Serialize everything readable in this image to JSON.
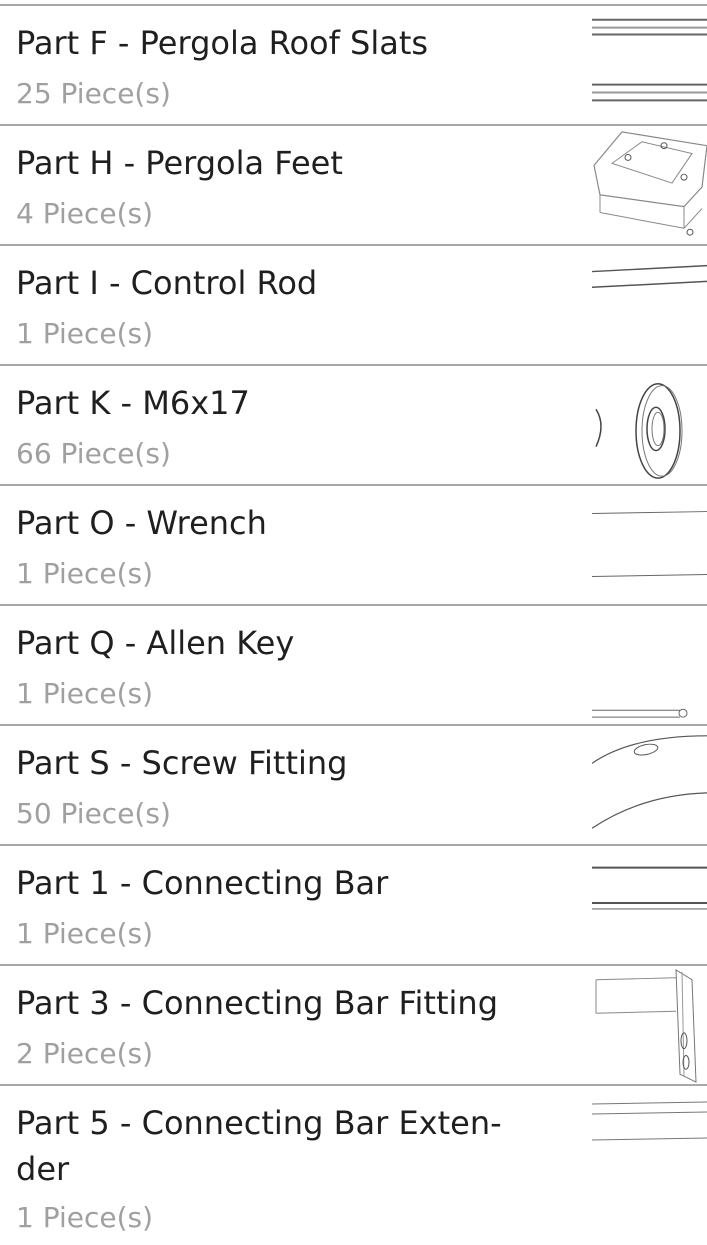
{
  "parts": [
    {
      "title": "Part F - Pergola Roof Slats",
      "qty": "25 Piece(s)",
      "icon": "slats-icon"
    },
    {
      "title": "Part H - Pergola Feet",
      "qty": "4 Piece(s)",
      "icon": "feet-plate-icon"
    },
    {
      "title": "Part I - Control Rod",
      "qty": "1 Piece(s)",
      "icon": "rod-icon"
    },
    {
      "title": "Part K - M6x17",
      "qty": "66 Piece(s)",
      "icon": "washer-icon"
    },
    {
      "title": "Part O - Wrench",
      "qty": "1 Piece(s)",
      "icon": "wrench-icon"
    },
    {
      "title": "Part Q - Allen Key",
      "qty": "1 Piece(s)",
      "icon": "allen-key-icon"
    },
    {
      "title": "Part S - Screw Fitting",
      "qty": "50 Piece(s)",
      "icon": "screw-fitting-icon"
    },
    {
      "title": "Part 1 - Connecting Bar",
      "qty": "1 Piece(s)",
      "icon": "connecting-bar-icon"
    },
    {
      "title": "Part 3 - Connecting Bar Fitting",
      "qty": "2 Piece(s)",
      "icon": "bar-fitting-icon"
    },
    {
      "title": "Part 5 - Connecting Bar Exten-der",
      "title_line1": "Part 5 - Connecting Bar Exten-",
      "title_line2": "der",
      "qty": "1 Piece(s)",
      "icon": "bar-extender-icon"
    }
  ]
}
